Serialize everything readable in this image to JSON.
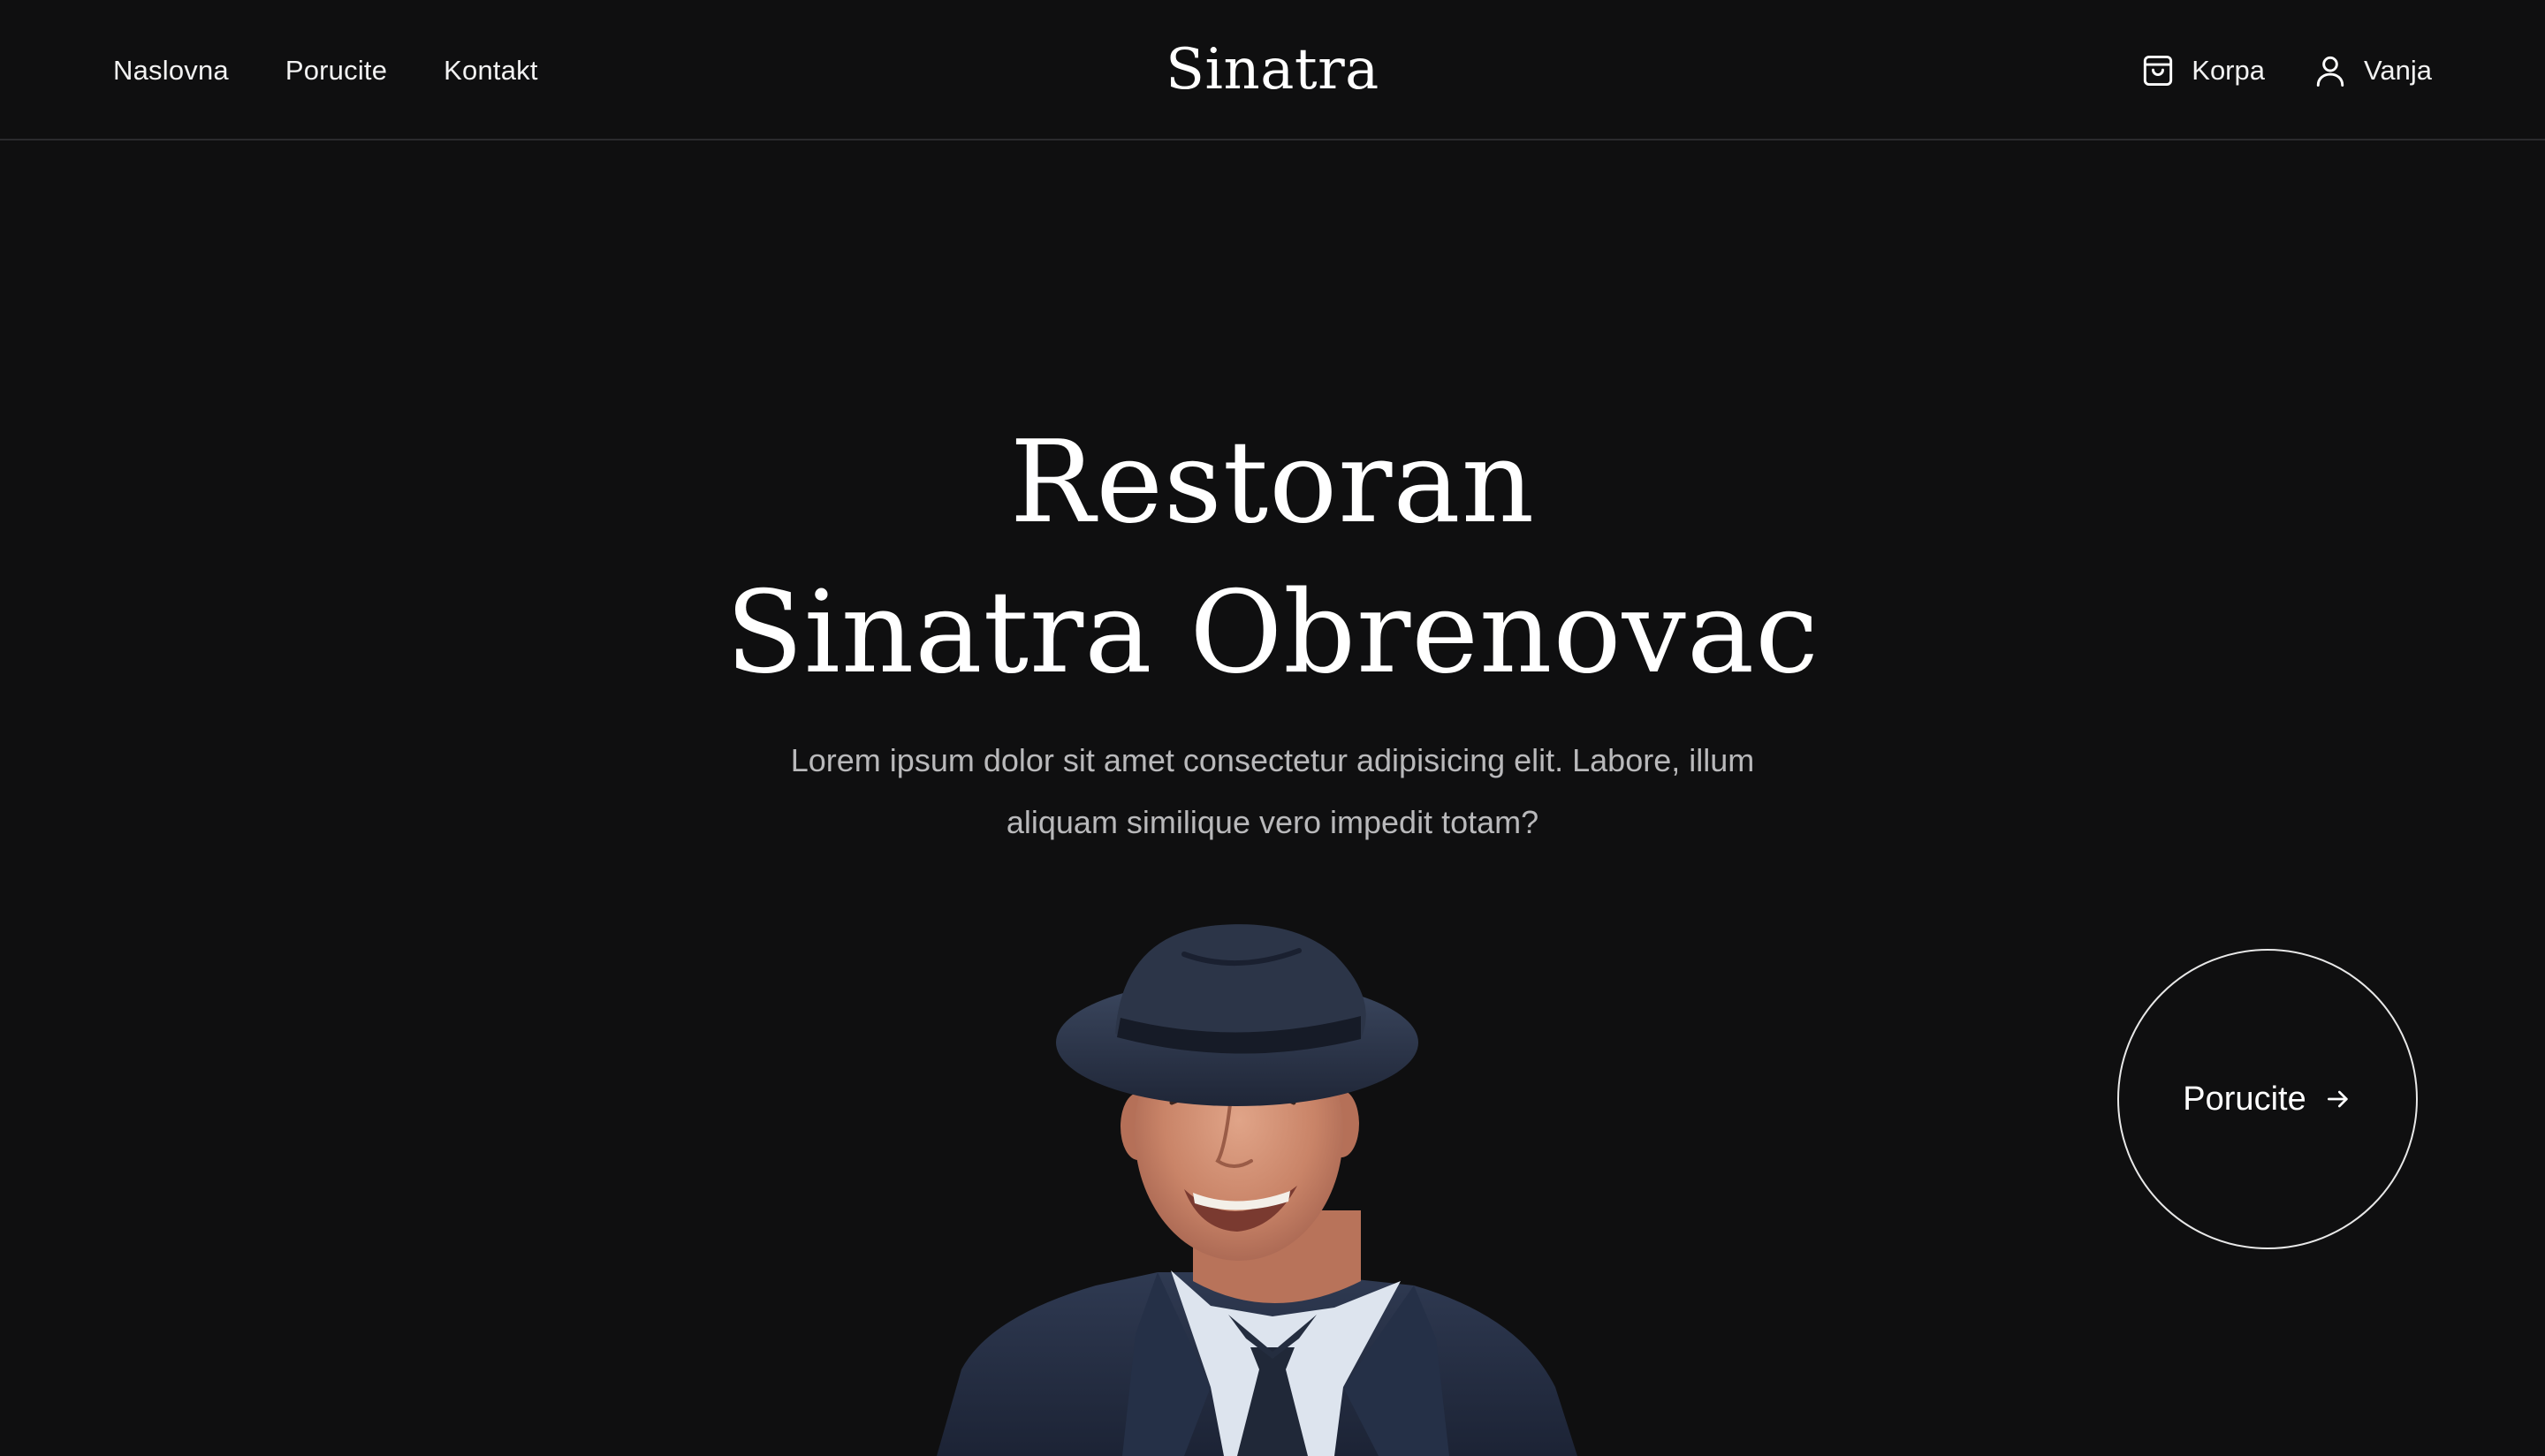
{
  "header": {
    "nav": [
      {
        "label": "Naslovna"
      },
      {
        "label": "Porucite"
      },
      {
        "label": "Kontakt"
      }
    ],
    "brand": "Sinatra",
    "cart": {
      "label": "Korpa",
      "icon": "shopping-bag-icon"
    },
    "user": {
      "label": "Vanja",
      "icon": "user-icon"
    }
  },
  "hero": {
    "title_line1": "Restoran",
    "title_line2": "Sinatra Obrenovac",
    "description": "Lorem ipsum dolor sit amet consectetur adipisicing elit. Labore, illum aliquam similique vero impedit totam?"
  },
  "cta": {
    "label": "Porucite",
    "icon": "arrow-right-icon"
  },
  "colors": {
    "background": "#0f0f10",
    "text": "#ffffff",
    "muted_text": "#b9b9bb",
    "divider": "#2b2b2d"
  }
}
